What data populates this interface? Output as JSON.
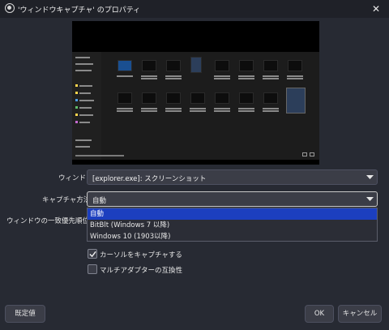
{
  "window": {
    "title": "'ウィンドウキャプチャ' のプロパティ",
    "close_symbol": "✕"
  },
  "form": {
    "window_label": "ウィンドウ",
    "window_value": "[explorer.exe]: スクリーンショット",
    "capture_method_label": "キャプチャ方法",
    "capture_method_value": "自動",
    "priority_label": "ウィンドウの一致優先順位",
    "capture_method_options": [
      "自動",
      "BitBlt (Windows 7 以降)",
      "Windows 10 (1903以降)"
    ],
    "selected_option_index": 0
  },
  "checkboxes": [
    {
      "label": "カーソルをキャプチャする",
      "checked": true
    },
    {
      "label": "マルチアダプターの互換性",
      "checked": false
    }
  ],
  "buttons": {
    "defaults": "既定値",
    "ok": "OK",
    "cancel": "キャンセル"
  },
  "colors": {
    "background": "#272a33",
    "titlebar": "#1f2128",
    "control": "#3b3d47",
    "selection": "#1c3fbf"
  },
  "icons": {
    "app": "obs-icon",
    "close": "close-icon",
    "dropdown": "chevron-down-icon",
    "check": "checkmark-icon"
  }
}
